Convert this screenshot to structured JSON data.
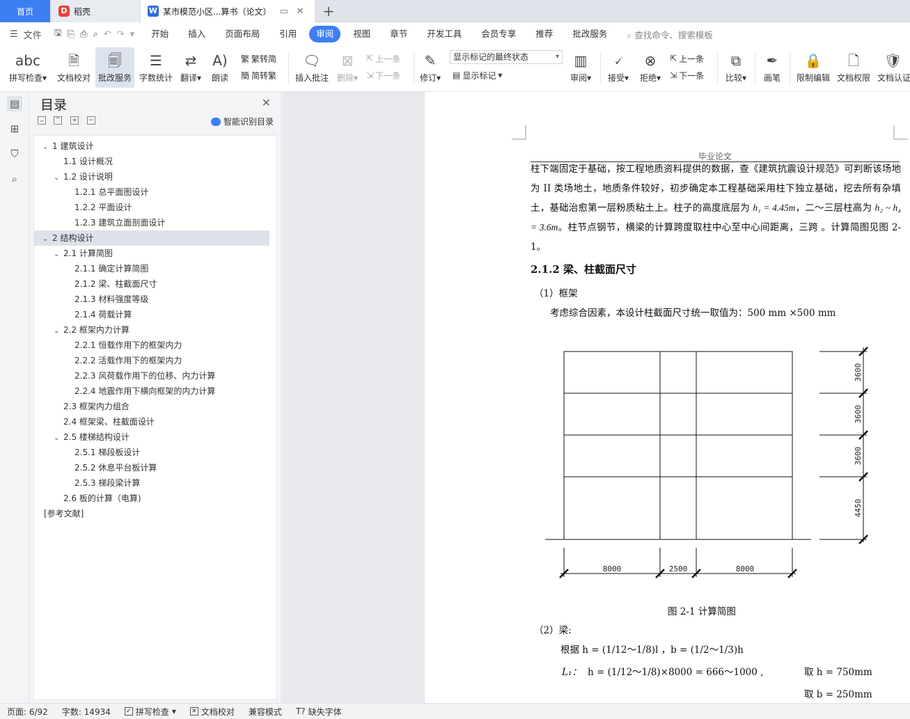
{
  "tabs": {
    "home": "首页",
    "docer": "稻壳",
    "doc_title": "某市模范小区...算书（论文）",
    "close": "✕",
    "add": "+"
  },
  "menu": {
    "file": "文件",
    "items": [
      "开始",
      "插入",
      "页面布局",
      "引用",
      "审阅",
      "视图",
      "章节",
      "开发工具",
      "会员专享",
      "推荐",
      "批改服务"
    ],
    "active": "审阅",
    "search": "查找命令、搜索模板"
  },
  "ribbon": {
    "spell": "拼写检查",
    "proof": "文档校对",
    "grading": "批改服务",
    "wordcount": "字数统计",
    "translate": "翻译",
    "read": "朗读",
    "s2t": "繁转简",
    "t2s": "简转繁",
    "insert_comment": "插入批注",
    "delete": "删除",
    "prev_comment": "上一条",
    "next_comment": "下一条",
    "track": "修订",
    "markup_state": "显示标记的最终状态",
    "show_markup": "显示标记",
    "review": "审阅",
    "accept": "接受",
    "reject": "拒绝",
    "prev_change": "上一条",
    "next_change": "下一条",
    "compare": "比较",
    "pen": "画笔",
    "restrict": "限制编辑",
    "permission": "文档权限",
    "certify": "文档认证"
  },
  "nav": {
    "title": "目录",
    "smart": "智能识别目录",
    "toc": [
      {
        "label": "1  建筑设计",
        "level": 0,
        "arrow": "v"
      },
      {
        "label": "1.1  设计概况",
        "level": 1,
        "arrow": ""
      },
      {
        "label": "1.2  设计说明",
        "level": 1,
        "arrow": "v"
      },
      {
        "label": "1.2.1  总平面图设计",
        "level": 2,
        "arrow": ""
      },
      {
        "label": "1.2.2  平面设计",
        "level": 2,
        "arrow": ""
      },
      {
        "label": "1.2.3 建筑立面剖面设计",
        "level": 2,
        "arrow": ""
      },
      {
        "label": "2  结构设计",
        "level": 0,
        "arrow": "v",
        "selected": true
      },
      {
        "label": "2.1  计算简图",
        "level": 1,
        "arrow": "v"
      },
      {
        "label": "2.1.1  确定计算简图",
        "level": 2,
        "arrow": ""
      },
      {
        "label": "2.1.2  梁、柱截面尺寸",
        "level": 2,
        "arrow": ""
      },
      {
        "label": "2.1.3  材料强度等级",
        "level": 2,
        "arrow": ""
      },
      {
        "label": "2.1.4  荷载计算",
        "level": 2,
        "arrow": ""
      },
      {
        "label": "2.2  框架内力计算",
        "level": 1,
        "arrow": "v"
      },
      {
        "label": "2.2.1  恒载作用下的框架内力",
        "level": 2,
        "arrow": ""
      },
      {
        "label": "2.2.2  活载作用下的框架内力",
        "level": 2,
        "arrow": ""
      },
      {
        "label": "2.2.3  风荷载作用下的位移、内力计算",
        "level": 2,
        "arrow": ""
      },
      {
        "label": "2.2.4 地震作用下横向框架的内力计算",
        "level": 2,
        "arrow": ""
      },
      {
        "label": "2.3  框架内力组合",
        "level": 1,
        "arrow": ""
      },
      {
        "label": "2.4  框架梁、柱截面设计",
        "level": 1,
        "arrow": ""
      },
      {
        "label": "2.5 楼梯结构设计",
        "level": 1,
        "arrow": "v"
      },
      {
        "label": "2.5.1  梯段板设计",
        "level": 2,
        "arrow": ""
      },
      {
        "label": "2.5.2  休息平台板计算",
        "level": 2,
        "arrow": ""
      },
      {
        "label": "2.5.3  梯段梁计算",
        "level": 2,
        "arrow": ""
      },
      {
        "label": "2.6 板的计算（电算)",
        "level": 1,
        "arrow": ""
      },
      {
        "label": "[参考文献]",
        "level": 0,
        "arrow": "none"
      }
    ]
  },
  "doc": {
    "header": "毕业论文",
    "p1_a": "柱下端固定于基础，按工程地质资料提供的数据，查《建筑抗震设计规范》可判断该场地为 II 类场地土，地质条件较好，初步确定本工程基础采用柱下独立基础，挖去所有杂填土，基础治愈第一层粉质粘土上。柱子的高度底层为 ",
    "p1_m1": "h₁ = 4.45m",
    "p1_b": "，二～三层柱高为 ",
    "p1_m2": "h₂ ~ h₄ = 3.6m",
    "p1_c": "。柱节点钢节，横梁的计算跨度取柱中心至中心间距离，三跨  。计算简图见图 2-1。",
    "section": "2.1.2  梁、柱截面尺寸",
    "frame_head": "（1）框架",
    "frame_text": "考虑综合因素，本设计柱截面尺寸统一取值为：500 mm ×500 mm",
    "fig_caption": "图 2-1 计算简图",
    "beam_head": "（2）梁:",
    "beam_rule": "根据 h =  (1/12～1/8)l ，b = (1/2～1/3)h",
    "l1_label": "L₁：",
    "l1_formula": "h =  (1/12～1/8)×8000 = 666～1000 ,",
    "l1_take_h": "取 h = 750mm",
    "l1_take_b": "取 b = 250mm",
    "dims_x": [
      "8000",
      "2500",
      "8000"
    ],
    "dims_y": [
      "3600",
      "3600",
      "3600",
      "4450"
    ]
  },
  "status": {
    "page": "页面: 6/92",
    "words": "字数: 14934",
    "spell": "拼写检查",
    "proof": "文档校对",
    "compat": "兼容模式",
    "font": "缺失字体"
  }
}
